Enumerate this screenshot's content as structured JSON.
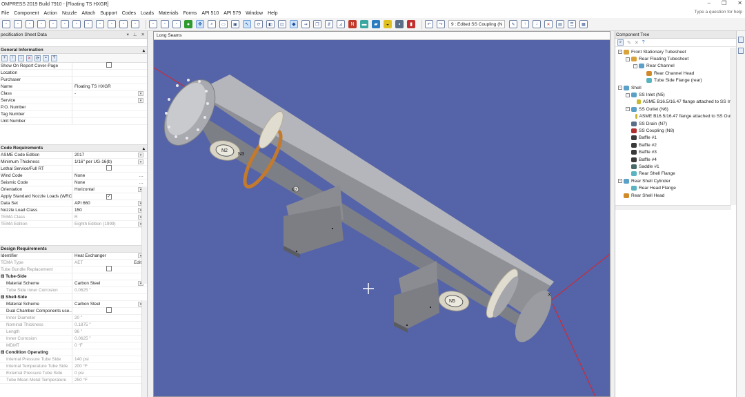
{
  "app": {
    "title": "OMPRESS 2019 Build 7910 - [Floating TS HXGR]",
    "help_search": "Type a question for help",
    "window_buttons": [
      "–",
      "❐",
      "✕"
    ]
  },
  "menu": [
    "File",
    "Component",
    "Action",
    "Nozzle",
    "Attach",
    "Support",
    "Codes",
    "Loads",
    "Materials",
    "Forms",
    "API 510",
    "API 579",
    "Window",
    "Help"
  ],
  "toolbar": {
    "component_dropdown": "9 : Edited SS Coupling (N"
  },
  "left_panel": {
    "title": "pecification Sheet Data",
    "general": {
      "title": "General Information",
      "rows": [
        {
          "label": "Show On Report Cover-Page",
          "value": "",
          "control": "checkbox",
          "checked": false
        },
        {
          "label": "Location",
          "value": ""
        },
        {
          "label": "Purchaser",
          "value": ""
        },
        {
          "label": "Name",
          "value": "Floating TS HXGR"
        },
        {
          "label": "Class",
          "value": "-",
          "control": "dropdown"
        },
        {
          "label": "Service",
          "value": "",
          "control": "dropdown"
        },
        {
          "label": "P.O. Number",
          "value": ""
        },
        {
          "label": "Tag Number",
          "value": ""
        },
        {
          "label": "Unit Number",
          "value": ""
        }
      ]
    },
    "code": {
      "title": "Code Requirements",
      "rows": [
        {
          "label": "ASME Code Edition",
          "value": "2017",
          "control": "dropdown"
        },
        {
          "label": "Minimum Thickness",
          "value": "1/16\" per UG-16(b)",
          "control": "dropdown"
        },
        {
          "label": "Lethal Service/Full RT",
          "value": "",
          "control": "checkbox",
          "checked": false
        },
        {
          "label": "Wind Code",
          "value": "None",
          "control": "ellipsis"
        },
        {
          "label": "Seismic Code",
          "value": "None",
          "control": "ellipsis"
        },
        {
          "label": "Orientation",
          "value": "Horizontal",
          "control": "dropdown"
        },
        {
          "label": "Apply Standard Nozzle Loads (WRC)",
          "value": "",
          "control": "checkbox",
          "checked": true
        },
        {
          "label": "Data Set",
          "value": "API 660",
          "control": "dropdown"
        },
        {
          "label": "Nozzle Load Class",
          "value": "150",
          "control": "dropdown"
        },
        {
          "label": "TEMA Class",
          "value": "R",
          "control": "dropdown",
          "disabled": true
        },
        {
          "label": "TEMA Edition",
          "value": "Eighth Edition (1999)",
          "control": "dropdown",
          "disabled": true
        }
      ]
    },
    "design": {
      "title": "Design Requirements",
      "rows": [
        {
          "label": "Identifier",
          "value": "Heat Exchanger",
          "control": "dropdown"
        },
        {
          "label": "TEMA Type",
          "value": "AET",
          "control": "edit",
          "edit_label": "Edit",
          "disabled": true
        },
        {
          "label": "Tube Bundle Replacement",
          "value": "",
          "control": "checkbox",
          "checked": false,
          "disabled": true
        },
        {
          "label": "Tube-Side",
          "value": "",
          "group": true
        },
        {
          "label": "Material Scheme",
          "value": "Carbon Steel",
          "control": "dropdown",
          "sub": true
        },
        {
          "label": "Tube Side Inner Corrosion",
          "value": "0.0625 \"",
          "sub": true,
          "disabled": true
        },
        {
          "label": "Shell-Side",
          "value": "",
          "group": true
        },
        {
          "label": "Material Scheme",
          "value": "Carbon Steel",
          "control": "dropdown",
          "sub": true
        },
        {
          "label": "Dual Chamber Components use...",
          "value": "",
          "control": "checkbox",
          "checked": false,
          "sub": true
        },
        {
          "label": "Inner Diameter",
          "value": "20 \"",
          "sub": true,
          "disabled": true
        },
        {
          "label": "Nominal Thickness",
          "value": "0.1875 \"",
          "sub": true,
          "disabled": true
        },
        {
          "label": "Length",
          "value": "96 \"",
          "sub": true,
          "disabled": true
        },
        {
          "label": "Inner Corrosion",
          "value": "0.0625 \"",
          "sub": true,
          "disabled": true
        },
        {
          "label": "MDMT",
          "value": "0 °F",
          "sub": true,
          "disabled": true
        },
        {
          "label": "Condition Operating",
          "value": "",
          "group": true
        },
        {
          "label": "Internal Pressure Tube Side",
          "value": "140 psi",
          "sub": true,
          "disabled": true
        },
        {
          "label": "Internal Temperature Tube Side",
          "value": "200 °F",
          "sub": true,
          "disabled": true
        },
        {
          "label": "External Pressure Tube Side",
          "value": "0 psi",
          "sub": true,
          "disabled": true
        },
        {
          "label": "Tube Mean Metal Temperature",
          "value": "250 °F",
          "sub": true,
          "disabled": true
        }
      ]
    }
  },
  "viewport": {
    "tab_label": "Long Seams",
    "background": "#5563a9",
    "nozzle_labels": [
      "N2",
      "N3",
      "N7",
      "N5"
    ],
    "axis_label": "X"
  },
  "component_tree": {
    "title": "Component Tree",
    "nodes": [
      {
        "label": "Front Stationary Tubesheet",
        "level": 0,
        "icon_color": "#d9a23a",
        "exp": "-"
      },
      {
        "label": "Rear Floating Tubesheet",
        "level": 1,
        "icon_color": "#d9a23a",
        "exp": "-"
      },
      {
        "label": "Rear Channel",
        "level": 2,
        "icon_color": "#5aa0c8",
        "exp": "-"
      },
      {
        "label": "Rear Channel Head",
        "level": 3,
        "icon_color": "#d18a2a"
      },
      {
        "label": "Tube Side Flange (rear)",
        "level": 3,
        "icon_color": "#5ab3c0"
      },
      {
        "label": "Shell",
        "level": 0,
        "icon_color": "#5aa0c8",
        "exp": "-"
      },
      {
        "label": "SS Inlet (N5)",
        "level": 1,
        "icon_color": "#5aa0c8",
        "exp": "-"
      },
      {
        "label": "ASME B16.5/16.47 flange attached to SS Inlet",
        "level": 2,
        "icon_color": "#c8b830"
      },
      {
        "label": "SS Outlet (N6)",
        "level": 1,
        "icon_color": "#5aa0c8",
        "exp": "-"
      },
      {
        "label": "ASME B16.5/16.47 flange attached to SS Outlet",
        "level": 2,
        "icon_color": "#c8b830"
      },
      {
        "label": "SS Drain (N7)",
        "level": 1,
        "icon_color": "#5a6e8a"
      },
      {
        "label": "SS Coupling (N8)",
        "level": 1,
        "icon_color": "#b03030"
      },
      {
        "label": "Baffle #1",
        "level": 1,
        "icon_color": "#3a3a3a"
      },
      {
        "label": "Baffle #2",
        "level": 1,
        "icon_color": "#3a3a3a"
      },
      {
        "label": "Baffle #3",
        "level": 1,
        "icon_color": "#3a3a3a"
      },
      {
        "label": "Baffle #4",
        "level": 1,
        "icon_color": "#3a3a3a"
      },
      {
        "label": "Saddle #1",
        "level": 1,
        "icon_color": "#4a6a6a"
      },
      {
        "label": "Rear Shell Flange",
        "level": 1,
        "icon_color": "#5ab3c0"
      },
      {
        "label": "Rear Shell Cylinder",
        "level": 0,
        "icon_color": "#5aa0c8",
        "exp": "-"
      },
      {
        "label": "Rear Head Flange",
        "level": 1,
        "icon_color": "#5ab3c0"
      },
      {
        "label": "Rear Shell Head",
        "level": 0,
        "icon_color": "#d18a2a"
      }
    ]
  },
  "colors": {
    "viewport_bg": "#5563a9",
    "vessel": "#9c9ea4",
    "accent_selected": "#cfe3fb"
  }
}
